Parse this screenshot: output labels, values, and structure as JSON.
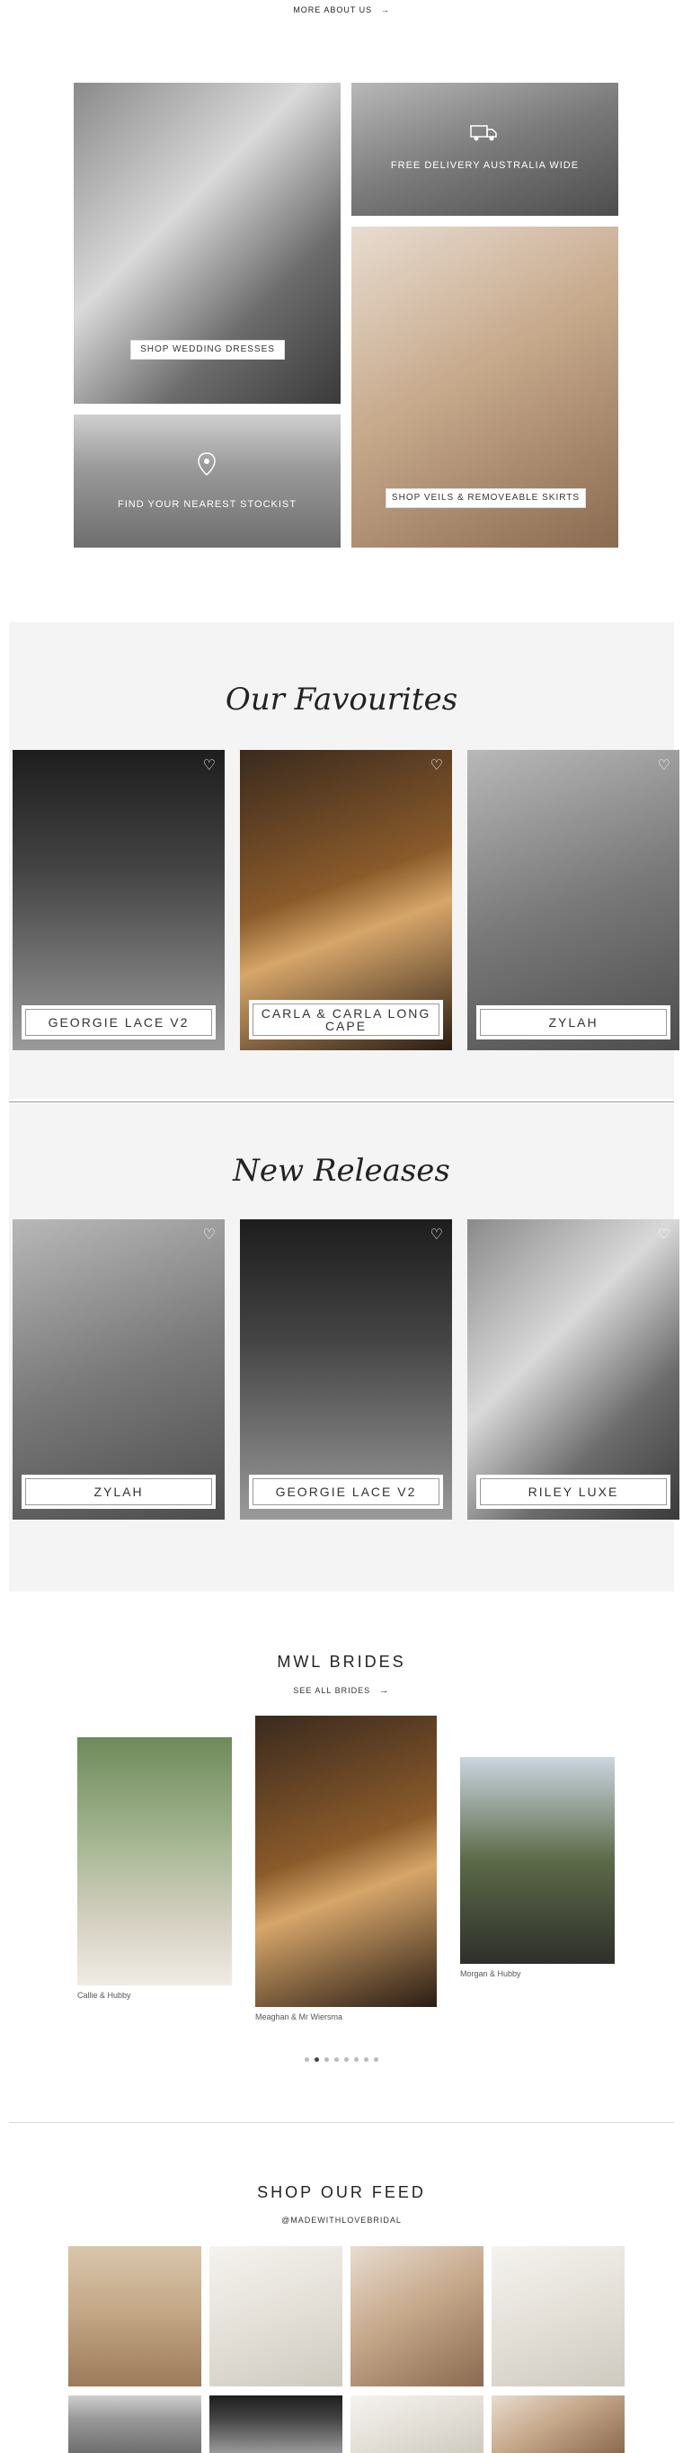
{
  "header": {
    "more_about_label": "MORE ABOUT US",
    "arrow": "→"
  },
  "promo": {
    "shop_dresses": "SHOP WEDDING DRESSES",
    "delivery": "FREE DELIVERY AUSTRALIA WIDE",
    "stockists": "FIND YOUR NEAREST STOCKIST",
    "veils": "SHOP VEILS & REMOVEABLE SKIRTS"
  },
  "favourites": {
    "title": "Our Favourites",
    "items": [
      {
        "label": "GEORGIE LACE V2"
      },
      {
        "label": "CARLA & CARLA LONG CAPE"
      },
      {
        "label": "ZYLAH"
      }
    ]
  },
  "releases": {
    "title": "New Releases",
    "items": [
      {
        "label": "ZYLAH"
      },
      {
        "label": "GEORGIE LACE V2"
      },
      {
        "label": "RILEY LUXE"
      }
    ]
  },
  "brides": {
    "title": "MWL BRIDES",
    "see_all": "SEE ALL BRIDES",
    "arrow": "→",
    "captions": [
      "Callie & Hubby",
      "Meaghan & Mr Wiersma",
      "Morgan & Hubby"
    ],
    "slides": 8,
    "active": 1
  },
  "feed": {
    "title": "SHOP OUR FEED",
    "handle": "@MADEWITHLOVEBRIDAL"
  },
  "icons": {
    "heart": "heart-icon",
    "truck": "truck-icon",
    "pin": "location-pin-icon",
    "arrow": "arrow-right-icon"
  }
}
